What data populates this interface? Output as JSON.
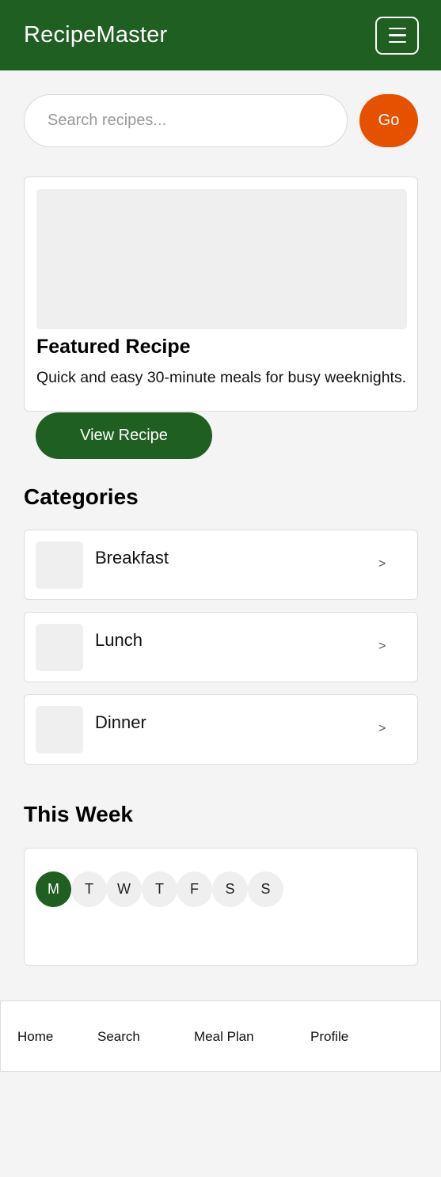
{
  "header": {
    "title": "RecipeMaster",
    "menu_icon": "hamburger-menu-icon"
  },
  "search": {
    "placeholder": "Search recipes...",
    "value": "",
    "button_label": "Go"
  },
  "featured": {
    "title": "Featured Recipe",
    "description": "Quick and easy 30-minute meals for busy weeknights.",
    "button_label": "View Recipe"
  },
  "categories": {
    "title": "Categories",
    "items": [
      {
        "label": "Breakfast",
        "chevron": ">"
      },
      {
        "label": "Lunch",
        "chevron": ">"
      },
      {
        "label": "Dinner",
        "chevron": ">"
      }
    ]
  },
  "week": {
    "title": "This Week",
    "days": [
      "M",
      "T",
      "W",
      "T",
      "F",
      "S",
      "S"
    ],
    "selected": "M"
  },
  "bottom_nav": {
    "items": [
      "Home",
      "Search",
      "Meal Plan",
      "Profile"
    ]
  },
  "colors": {
    "primary": "#1f5f22",
    "accent": "#e65100",
    "background": "#f4f4f4"
  }
}
